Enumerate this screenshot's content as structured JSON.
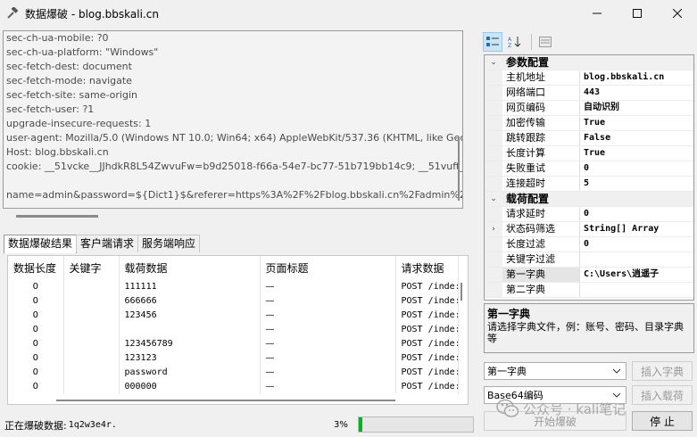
{
  "window": {
    "title": "数据爆破 - blog.bbskali.cn",
    "minimize_icon": "minimize-icon",
    "maximize_icon": "maximize-icon",
    "close_icon": "close-icon"
  },
  "request": {
    "lines": [
      "sec-ch-ua-mobile: ?0",
      "sec-ch-ua-platform: \"Windows\"",
      "sec-fetch-dest: document",
      "sec-fetch-mode: navigate",
      "sec-fetch-site: same-origin",
      "sec-fetch-user: ?1",
      "upgrade-insecure-requests: 1",
      "user-agent: Mozilla/5.0 (Windows NT 10.0; Win64; x64) AppleWebKit/537.36 (KHTML, like Gecko)",
      "Host: blog.bbskali.cn",
      "cookie: __51vcke__JJhdkR8L54ZwvuFw=b9d25018-f66a-54e7-bc77-51b719bb14c9; __51vuft__JJhdkR",
      "",
      "name=admin&password=${Dict1}$&referer=https%3A%2F%2Fblog.bbskali.cn%2Fadmin%2F"
    ]
  },
  "tabs": [
    "数据爆破结果",
    "客户端请求",
    "服务端响应"
  ],
  "results": {
    "columns": [
      "数据长度",
      "关键字",
      "载荷数据",
      "页面标题",
      "请求数据"
    ],
    "rows": [
      {
        "length": "0",
        "keyword": "",
        "payload": "111111",
        "title": "—",
        "request": "POST /inde:"
      },
      {
        "length": "0",
        "keyword": "",
        "payload": "666666",
        "title": "—",
        "request": "POST /inde:"
      },
      {
        "length": "0",
        "keyword": "",
        "payload": "123456",
        "title": "—",
        "request": "POST /inde:"
      },
      {
        "length": "0",
        "keyword": "",
        "payload": "",
        "title": "—",
        "request": "POST /inde:"
      },
      {
        "length": "0",
        "keyword": "",
        "payload": "123456789",
        "title": "—",
        "request": "POST /inde:"
      },
      {
        "length": "0",
        "keyword": "",
        "payload": "123123",
        "title": "—",
        "request": "POST /inde:"
      },
      {
        "length": "0",
        "keyword": "",
        "payload": "password",
        "title": "—",
        "request": "POST /inde:"
      },
      {
        "length": "0",
        "keyword": "",
        "payload": "000000",
        "title": "—",
        "request": "POST /inde:"
      }
    ]
  },
  "status": {
    "label": "正在爆破数据:",
    "value": "1q2w3e4r.",
    "percent_text": "3%",
    "progress_fraction": 0.03,
    "progress_color": "#06b025"
  },
  "propgrid": {
    "toolbar_icons": [
      "categorized-icon",
      "alphabetical-icon",
      "property-pages-icon"
    ],
    "categories": [
      {
        "name": "参数配置",
        "items": [
          {
            "name": "主机地址",
            "value": "blog.bbskali.cn",
            "bold": true
          },
          {
            "name": "网络端口",
            "value": "443",
            "bold": true
          },
          {
            "name": "网页编码",
            "value": "自动识别",
            "bold": true
          },
          {
            "name": "加密传输",
            "value": "True",
            "bold": true
          },
          {
            "name": "跳转跟踪",
            "value": "False",
            "bold": true
          },
          {
            "name": "长度计算",
            "value": "True",
            "bold": true
          },
          {
            "name": "失败重试",
            "value": "0",
            "bold": true
          },
          {
            "name": "连接超时",
            "value": "5",
            "bold": true
          }
        ]
      },
      {
        "name": "载荷配置",
        "items": [
          {
            "name": "请求延时",
            "value": "0",
            "bold": true
          },
          {
            "name": "状态码筛选",
            "value": "String[] Array",
            "bold": true,
            "expandable": true
          },
          {
            "name": "长度过滤",
            "value": "0",
            "bold": true
          },
          {
            "name": "关键字过滤",
            "value": "",
            "bold": false
          },
          {
            "name": "第一字典",
            "value": "C:\\Users\\逍遥子",
            "bold": true,
            "selected": true
          },
          {
            "name": "第二字典",
            "value": "",
            "bold": false
          }
        ]
      }
    ],
    "description": {
      "title": "第一字典",
      "text": "请选择字典文件，例：账号、密码、目录字典等"
    }
  },
  "controls": {
    "dict_select": "第一字典",
    "encode_select": "Base64编码",
    "insert_dict": "插入字典",
    "insert_payload": "插入载荷",
    "start_button": "开始爆破",
    "stop_button": "停 止"
  },
  "watermark": {
    "text": "公众号 · kali笔记",
    "icon": "wechat-icon"
  }
}
